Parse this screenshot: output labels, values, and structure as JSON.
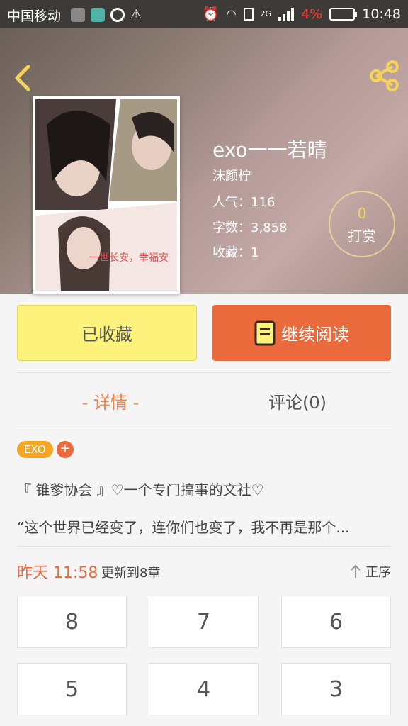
{
  "status_bar": {
    "carrier": "中国移动",
    "network": "2G",
    "battery": "4%",
    "time": "10:48"
  },
  "header": {
    "back_icon": "back-chevron-icon",
    "share_icon": "share-icon",
    "cover_text": [
      "一世长安，幸福安"
    ],
    "title": "exo一一若晴",
    "author": "沫颜柠",
    "popularity": "人气：116",
    "words": "字数：3,858",
    "favorites": "收藏：1",
    "reward_count": "0",
    "reward_label": "打赏"
  },
  "actions": {
    "favorite_label": "已收藏",
    "read_label": "继续阅读"
  },
  "tabs": {
    "detail": "- 详情 -",
    "comment": "评论(0)"
  },
  "tags": {
    "exo": "EXO",
    "add": "+"
  },
  "description": {
    "line1": "『 锥爹协会 』♡一个专门搞事的文社♡",
    "line2": "“这个世界已经变了，连你们也变了，我不再是那个..."
  },
  "update": {
    "time": "昨天 11:58",
    "text": "更新到8章",
    "sort": "正序"
  },
  "chapters": [
    "8",
    "7",
    "6",
    "5",
    "4",
    "3"
  ],
  "colors": {
    "accent": "#ea6a3b",
    "favorite_bg": "#fdf27b",
    "tab_active": "#f0854e"
  }
}
